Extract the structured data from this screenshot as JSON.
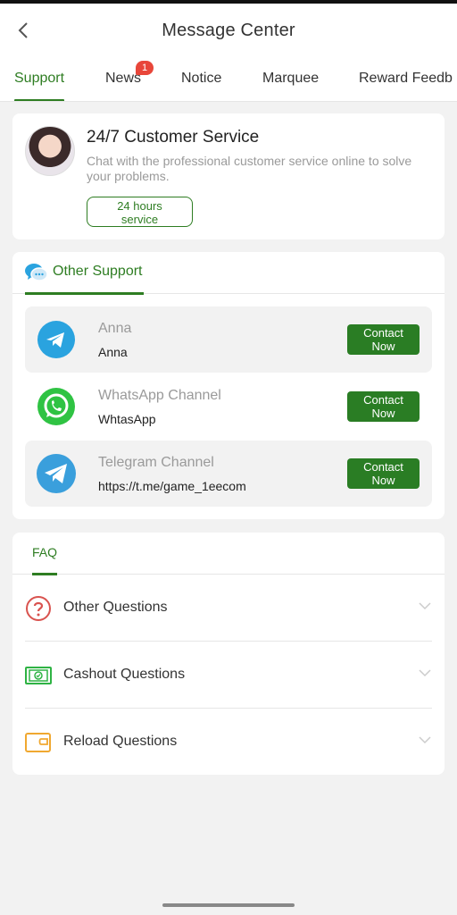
{
  "header": {
    "title": "Message Center"
  },
  "tabs": [
    {
      "label": "Support",
      "active": true
    },
    {
      "label": "News",
      "badge": "1"
    },
    {
      "label": "Notice"
    },
    {
      "label": "Marquee"
    },
    {
      "label": "Reward Feedb"
    }
  ],
  "customer_service": {
    "title": "24/7 Customer Service",
    "description": "Chat with the professional customer service online to solve your problems.",
    "hours_badge": "24 hours service"
  },
  "other_support": {
    "section_label": "Other Support",
    "contacts": [
      {
        "name": "Anna",
        "detail": "Anna",
        "button": "Contact Now",
        "icon": "telegram-icon"
      },
      {
        "name": "WhatsApp Channel",
        "detail": "WhtasApp",
        "button": "Contact Now",
        "icon": "whatsapp-icon"
      },
      {
        "name": "Telegram Channel",
        "detail": "https://t.me/game_1eecom",
        "button": "Contact Now",
        "icon": "telegram-icon"
      }
    ]
  },
  "faq": {
    "section_label": "FAQ",
    "items": [
      {
        "label": "Other Questions",
        "icon": "question-icon"
      },
      {
        "label": "Cashout Questions",
        "icon": "cashout-icon"
      },
      {
        "label": "Reload Questions",
        "icon": "wallet-icon"
      }
    ]
  },
  "colors": {
    "accent": "#2e7d22",
    "badge": "#e8463a",
    "telegram": "#2aa3df",
    "whatsapp": "#2fc343"
  }
}
